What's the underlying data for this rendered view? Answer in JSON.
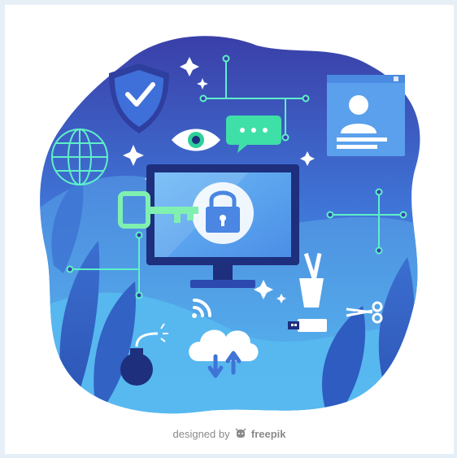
{
  "credit": {
    "prefix": "designed by",
    "brand": "freepik"
  },
  "icons": [
    "shield-check-icon",
    "globe-icon",
    "eye-icon",
    "chat-bubble-icon",
    "user-id-card-icon",
    "monitor-icon",
    "padlock-icon",
    "key-icon",
    "wifi-icon",
    "cloud-sync-icon",
    "bomb-icon",
    "usb-drive-icon",
    "scissors-icon",
    "cup-icon",
    "sparkle-icon",
    "leaf-icon"
  ],
  "colors": {
    "page_background": "#e6eef6",
    "frame_background": "#ffffff",
    "blob_top": "#3a3fa8",
    "blob_bottom": "#3fa3ea",
    "circuit_line": "#5ff0c8",
    "screen": "#5aa7f0",
    "key": "#7ff0b0",
    "credit_text": "#8a8a8a"
  }
}
